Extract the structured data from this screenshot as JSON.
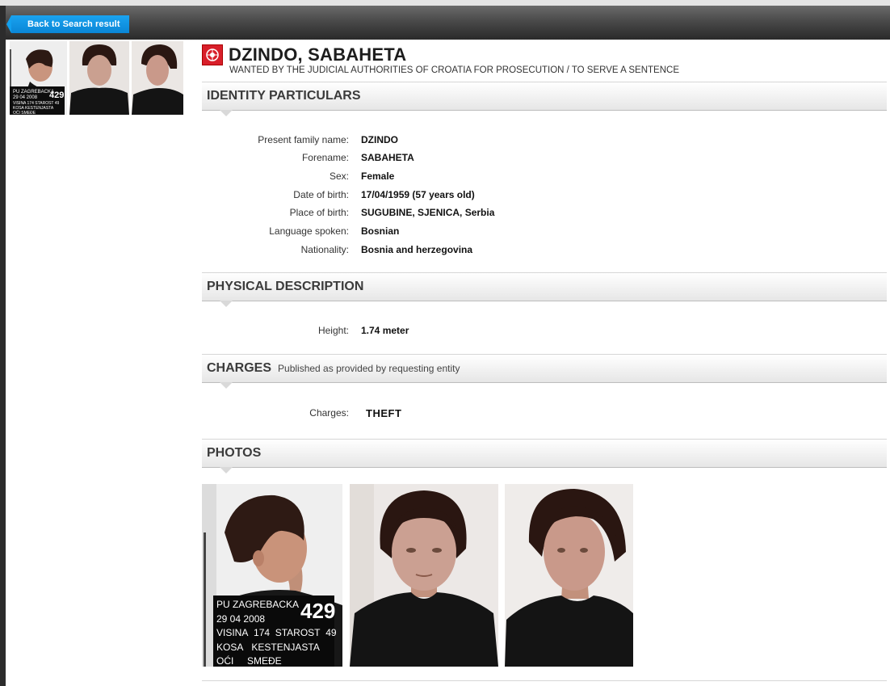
{
  "nav": {
    "back_label": "Back to Search result"
  },
  "person": {
    "name": "DZINDO, SABAHETA",
    "subtitle": "WANTED BY THE JUDICIAL AUTHORITIES OF CROATIA FOR PROSECUTION / TO SERVE A SENTENCE"
  },
  "sections": {
    "identity": "IDENTITY PARTICULARS",
    "physical": "PHYSICAL DESCRIPTION",
    "charges": "CHARGES",
    "charges_note": "Published as provided by requesting entity",
    "photos": "PHOTOS"
  },
  "identity": [
    {
      "label": "Present family name:",
      "value": "DZINDO"
    },
    {
      "label": "Forename:",
      "value": "SABAHETA"
    },
    {
      "label": "Sex:",
      "value": "Female"
    },
    {
      "label": "Date of birth:",
      "value": "17/04/1959 (57 years old)"
    },
    {
      "label": "Place of birth:",
      "value": "SUGUBINE, SJENICA, Serbia"
    },
    {
      "label": "Language spoken:",
      "value": "Bosnian"
    },
    {
      "label": "Nationality:",
      "value": "Bosnia and herzegovina"
    }
  ],
  "physical": [
    {
      "label": "Height:",
      "value": "1.74 meter"
    }
  ],
  "charges": {
    "label": "Charges:",
    "value": "THEFT"
  },
  "placard": {
    "line1": "PU ZAGREBACKA",
    "number": "429",
    "line2": "29 04 2008",
    "line3a": "VISINA",
    "line3b": "174",
    "line3c": "STAROST",
    "line3d": "49",
    "line4a": "KOSA",
    "line4b": "KESTENJASTA",
    "line5a": "OĆI",
    "line5b": "SMEĐE"
  },
  "colors": {
    "accent": "#0a86d6",
    "emblem": "#d81f2a"
  }
}
